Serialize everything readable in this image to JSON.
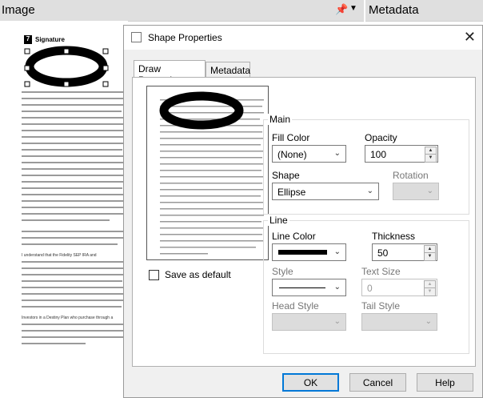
{
  "background": {
    "image_panel_title": "Image",
    "metadata_panel_title": "Metadata",
    "pin_icon": "pin-icon",
    "doc_section_number": "7",
    "doc_section_title": "Signature",
    "doc_paragraph_1": "I understand that the Fidelity SEP IRA and",
    "doc_paragraph_2": "Investors in a Destiny Plan who purchase through a"
  },
  "dialog": {
    "title": "Shape Properties",
    "close_icon": "close-icon",
    "tabs": [
      "Draw Properties",
      "Metadata"
    ],
    "main_group": {
      "label": "Main",
      "fill_color_label": "Fill Color",
      "fill_color_value": "(None)",
      "opacity_label": "Opacity",
      "opacity_value": "100",
      "shape_label": "Shape",
      "shape_value": "Ellipse",
      "rotation_label": "Rotation",
      "rotation_value": ""
    },
    "line_group": {
      "label": "Line",
      "line_color_label": "Line Color",
      "line_color_value": "#000000",
      "thickness_label": "Thickness",
      "thickness_value": "50",
      "style_label": "Style",
      "text_size_label": "Text Size",
      "text_size_value": "0",
      "head_style_label": "Head Style",
      "tail_style_label": "Tail Style"
    },
    "save_default_label": "Save as default",
    "buttons": {
      "ok": "OK",
      "cancel": "Cancel",
      "help": "Help"
    }
  }
}
